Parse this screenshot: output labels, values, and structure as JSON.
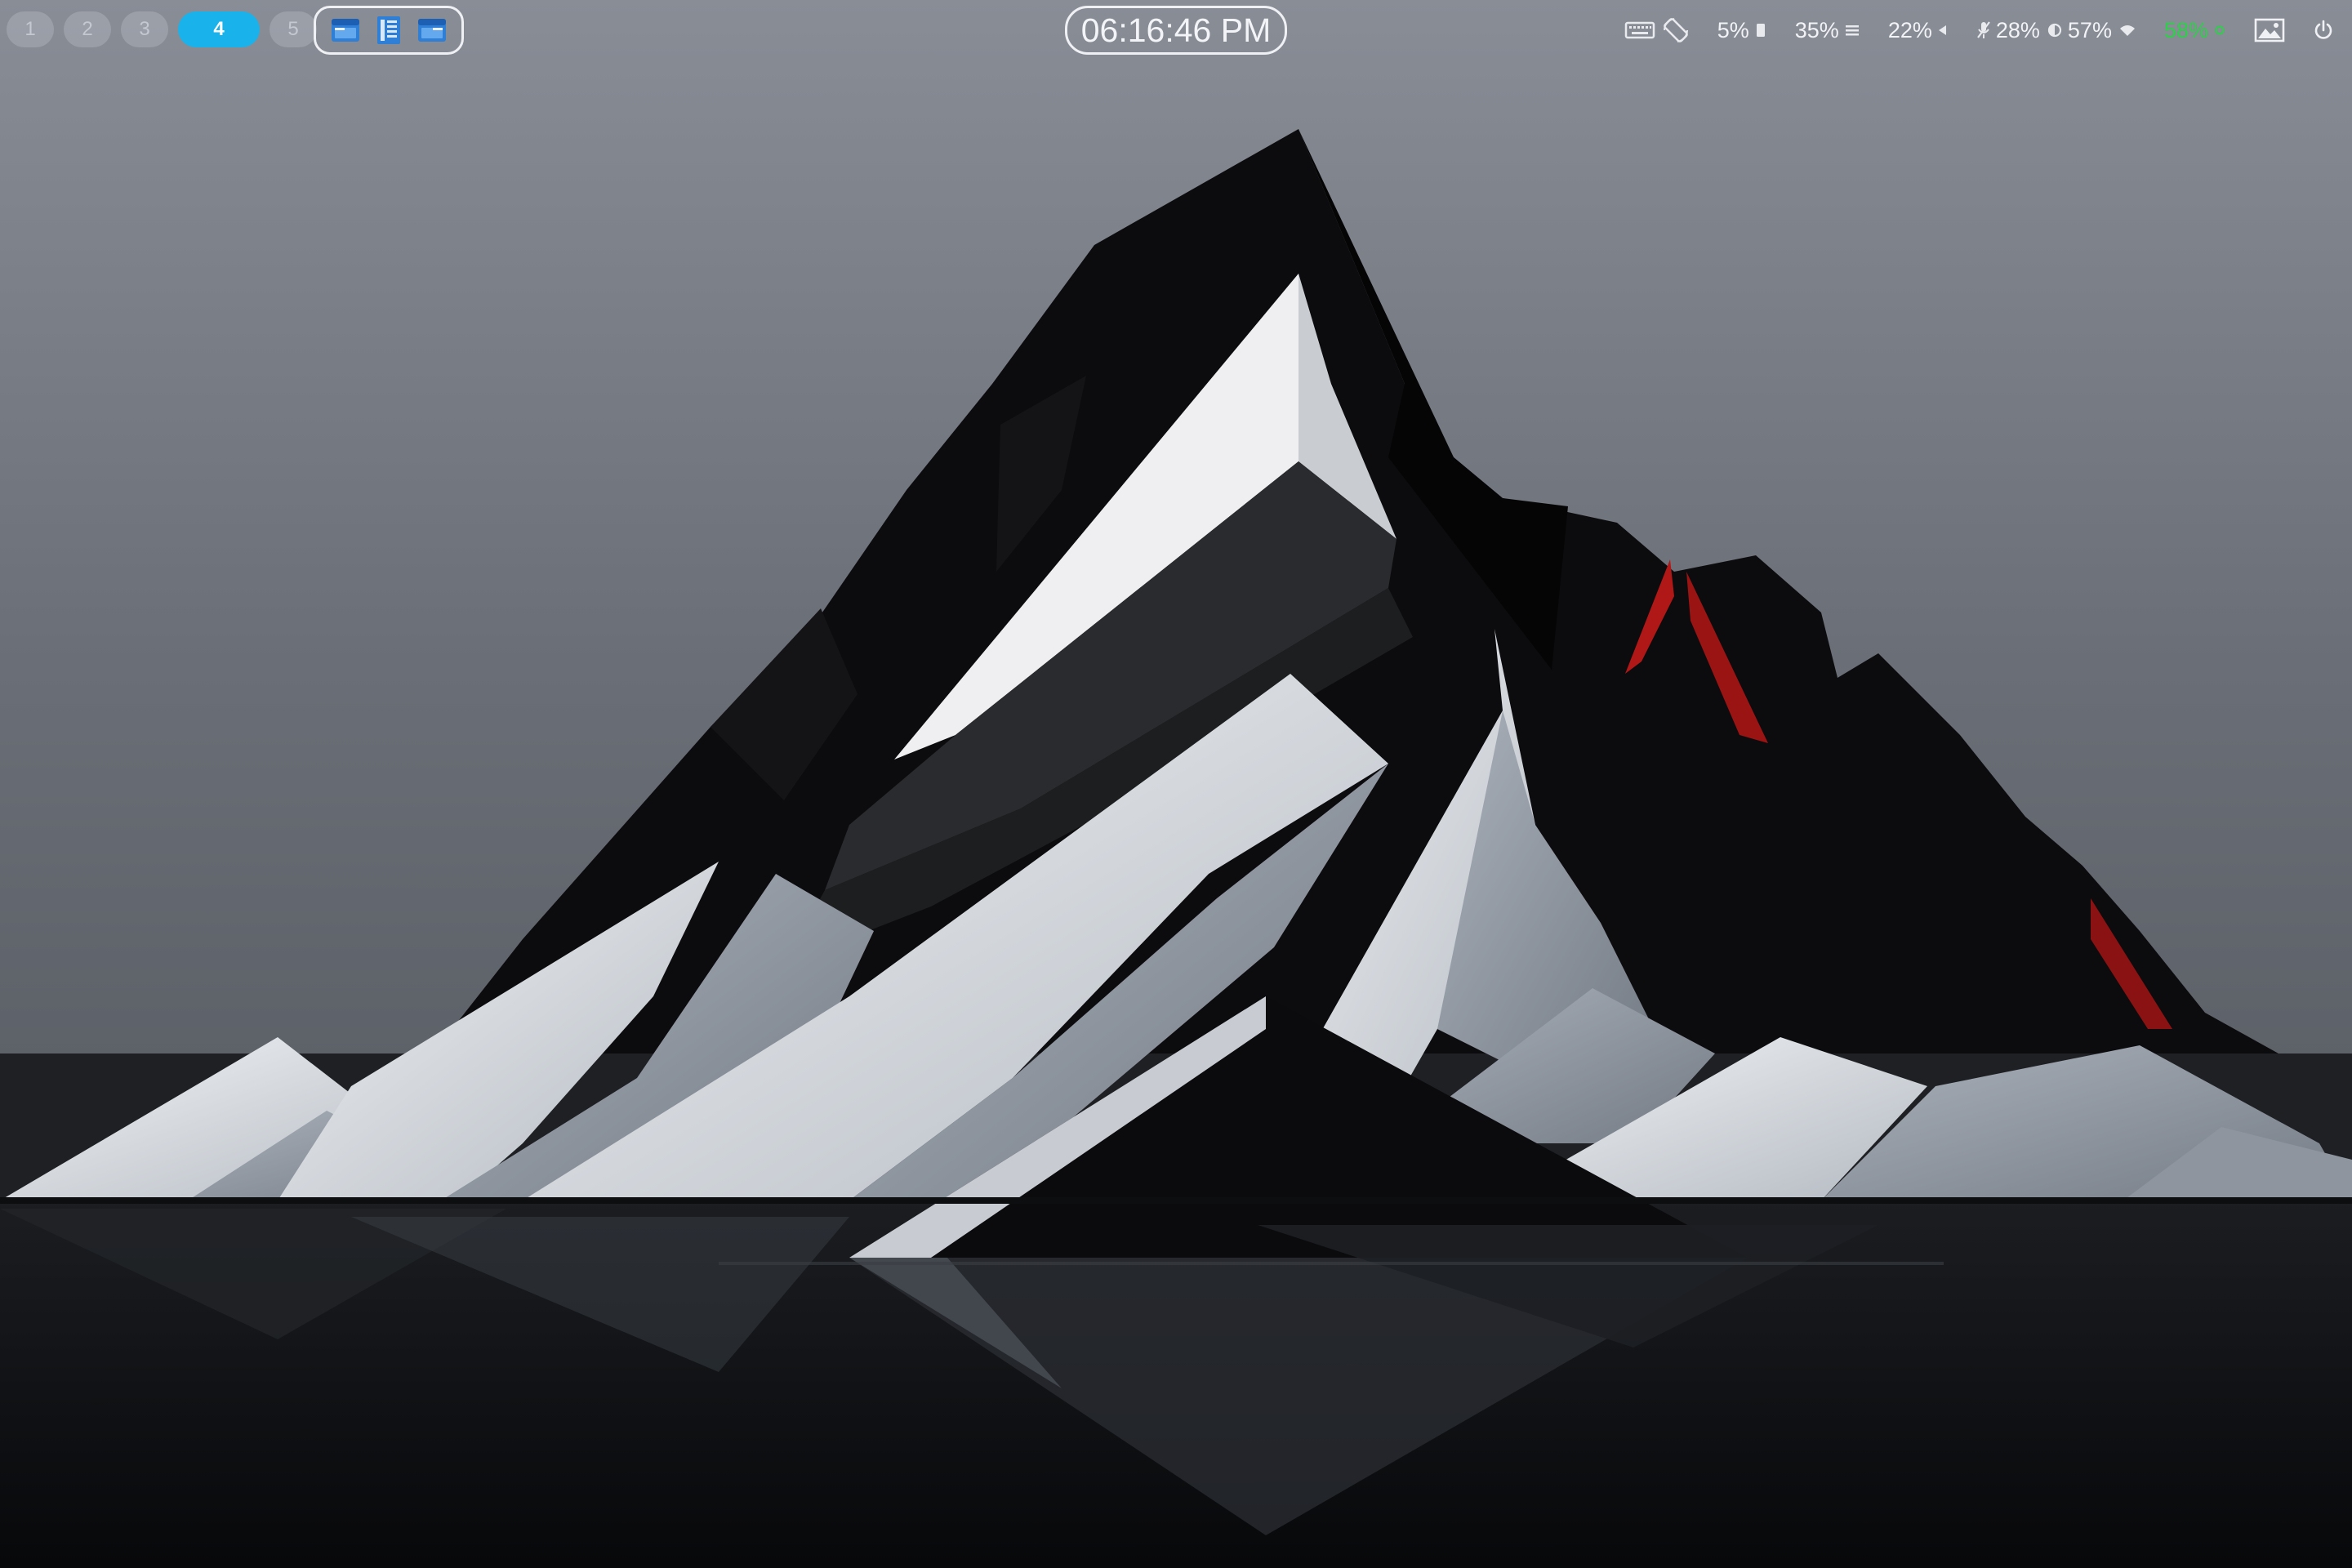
{
  "workspaces": [
    {
      "label": "1",
      "active": false
    },
    {
      "label": "2",
      "active": false
    },
    {
      "label": "3",
      "active": false
    },
    {
      "label": "4",
      "active": true
    },
    {
      "label": "5",
      "active": false
    }
  ],
  "tray_apps": [
    {
      "icon": "file-manager-icon"
    },
    {
      "icon": "document-viewer-icon"
    },
    {
      "icon": "file-manager-window-icon"
    }
  ],
  "clock": {
    "time": "06:16:46 PM"
  },
  "status": {
    "keyboard": {
      "icon": "keyboard-icon"
    },
    "rotation": {
      "icon": "screen-rotation-icon"
    },
    "cpu": {
      "value": "5%",
      "icon": "cpu-icon"
    },
    "memory": {
      "value": "35%",
      "icon": "memory-icon"
    },
    "volume": {
      "value": "22%",
      "icon": "volume-icon"
    },
    "microphone": {
      "value": "28%",
      "icon": "microphone-muted-icon"
    },
    "brightness": {
      "value": "57%",
      "icon": "brightness-icon"
    },
    "battery": {
      "value": "58%",
      "icon": "battery-charging-icon",
      "color": "#2ecf4a"
    },
    "wallpaper": {
      "icon": "wallpaper-icon"
    },
    "power": {
      "icon": "power-icon"
    }
  },
  "colors": {
    "accent": "#1ab2ea",
    "battery_green": "#2ecf4a",
    "border": "#eef0f4",
    "mountain_red": "#b01818"
  }
}
